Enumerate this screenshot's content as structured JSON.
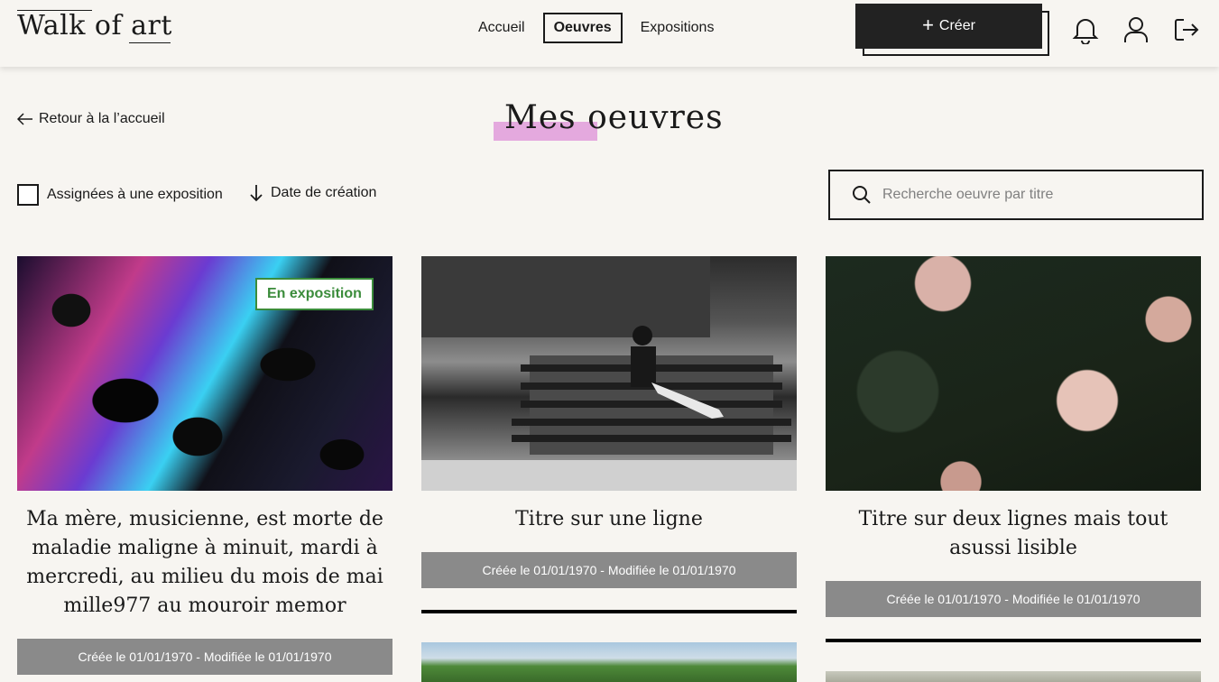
{
  "header": {
    "logo": "Walk of art",
    "nav": [
      {
        "label": "Accueil",
        "active": false
      },
      {
        "label": "Oeuvres",
        "active": true
      },
      {
        "label": "Expositions",
        "active": false
      }
    ],
    "create_label": "Créer",
    "icons": [
      "bell-icon",
      "user-icon",
      "logout-icon"
    ]
  },
  "page": {
    "back_label": "Retour à la l’accueil",
    "title": "Mes oeuvres",
    "highlight_color": "#e4a9de"
  },
  "filters": {
    "assigned_label": "Assignées à une exposition",
    "assigned_checked": false,
    "sort_label": "Date de création",
    "search_placeholder": "Recherche oeuvre par titre",
    "search_value": ""
  },
  "cards": [
    {
      "title": "Ma mère, musicienne, est morte de maladie maligne à minuit, mardi à mercredi, au milieu du mois de mai mille977 au mouroir memor",
      "meta": "Créée le 01/01/1970 - Modifiée le 01/01/1970",
      "badge": "En exposition",
      "image": "abstract-fluid-art"
    },
    {
      "title": "Titre sur une ligne",
      "meta": "Créée le 01/01/1970 - Modifiée le 01/01/1970",
      "badge": "",
      "image": "woman-on-bench-bw"
    },
    {
      "title": "Titre sur deux lignes mais tout asussi lisible",
      "meta": "Créée le 01/01/1970 - Modifiée le 01/01/1970",
      "badge": "",
      "image": "roses-dark"
    }
  ],
  "colors": {
    "background": "#f7f5f1",
    "dark": "#222222",
    "badge_green": "#3b8c3b",
    "meta_bar": "#8a8a8a"
  }
}
